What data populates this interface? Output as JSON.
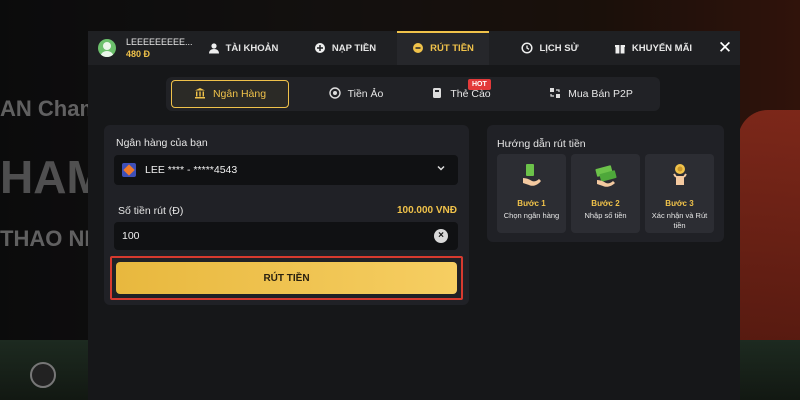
{
  "background": {
    "text_1": "AN Champ",
    "text_2": "HAM",
    "text_3": "THAO NH"
  },
  "user": {
    "name": "LEEEEEEEEE...",
    "balance": "480 Đ"
  },
  "tabs": [
    {
      "label": "TÀI KHOẢN",
      "icon": "user-cog-icon"
    },
    {
      "label": "NẠP TIỀN",
      "icon": "coin-plus-icon"
    },
    {
      "label": "RÚT TIỀN",
      "icon": "coin-withdraw-icon",
      "active": true
    },
    {
      "label": "LỊCH SỬ",
      "icon": "history-icon"
    },
    {
      "label": "KHUYẾN MÃI",
      "icon": "gift-icon"
    }
  ],
  "methods": [
    {
      "label": "Ngân Hàng",
      "icon": "bank-icon",
      "active": true
    },
    {
      "label": "Tiền Ảo",
      "icon": "crypto-coin-icon",
      "badge": "HOT"
    },
    {
      "label": "Thẻ Cào",
      "icon": "scratch-card-icon"
    },
    {
      "label": "Mua Bán P2P",
      "icon": "p2p-exchange-icon"
    }
  ],
  "form": {
    "bank_label": "Ngân hàng của bạn",
    "bank_value": "LEE **** - *****4543",
    "amount_label": "Số tiền rút (Đ)",
    "max_amount": "100.000 VNĐ",
    "amount_value": "100",
    "submit_label": "RÚT TIỀN"
  },
  "guide": {
    "title": "Hướng dẫn rút tiền",
    "steps": [
      {
        "title": "Bước 1",
        "desc": "Chọn ngân hàng",
        "icon": "hand-cash-icon"
      },
      {
        "title": "Bước 2",
        "desc": "Nhập số tiền",
        "icon": "money-stack-icon"
      },
      {
        "title": "Bước 3",
        "desc": "Xác nhận và Rút tiền",
        "icon": "hand-coin-icon"
      }
    ]
  },
  "colors": {
    "accent": "#f0c24a",
    "panel": "#202126",
    "modal": "#161719",
    "hot_badge": "#e33a3a",
    "highlight_border": "#d63a2f"
  }
}
